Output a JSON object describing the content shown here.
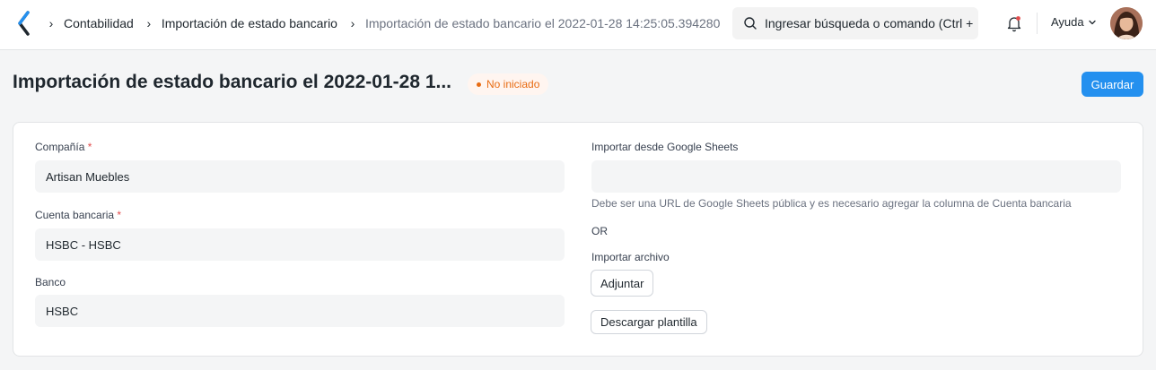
{
  "navbar": {
    "breadcrumbs": [
      {
        "label": "Contabilidad"
      },
      {
        "label": "Importación de estado bancario"
      },
      {
        "label": "Importación de estado bancario el 2022-01-28 14:25:05.394280"
      }
    ],
    "search_placeholder": "Ingresar búsqueda o comando (Ctrl + G)",
    "help_label": "Ayuda"
  },
  "page": {
    "title": "Importación de estado bancario el 2022-01-28 1...",
    "status_badge": "No iniciado",
    "save_label": "Guardar"
  },
  "form": {
    "company": {
      "label": "Compañía",
      "required_mark": "*",
      "value": "Artisan Muebles"
    },
    "bank_account": {
      "label": "Cuenta bancaria",
      "required_mark": "*",
      "value": "HSBC - HSBC"
    },
    "bank": {
      "label": "Banco",
      "value": "HSBC"
    },
    "google_sheets": {
      "label": "Importar desde Google Sheets",
      "value": "",
      "description": "Debe ser una URL de Google Sheets pública y es necesario agregar la columna de Cuenta bancaria"
    },
    "or_text": "OR",
    "import_file": {
      "label": "Importar archivo",
      "attach_label": "Adjuntar"
    },
    "download_template_label": "Descargar plantilla"
  },
  "colors": {
    "primary": "#2490ef",
    "status_orange": "#e86c13",
    "required_red": "#e24c4c"
  },
  "icons": [
    "logo-icon",
    "chevron-right-icon",
    "search-icon",
    "bell-icon",
    "chevron-down-icon"
  ]
}
